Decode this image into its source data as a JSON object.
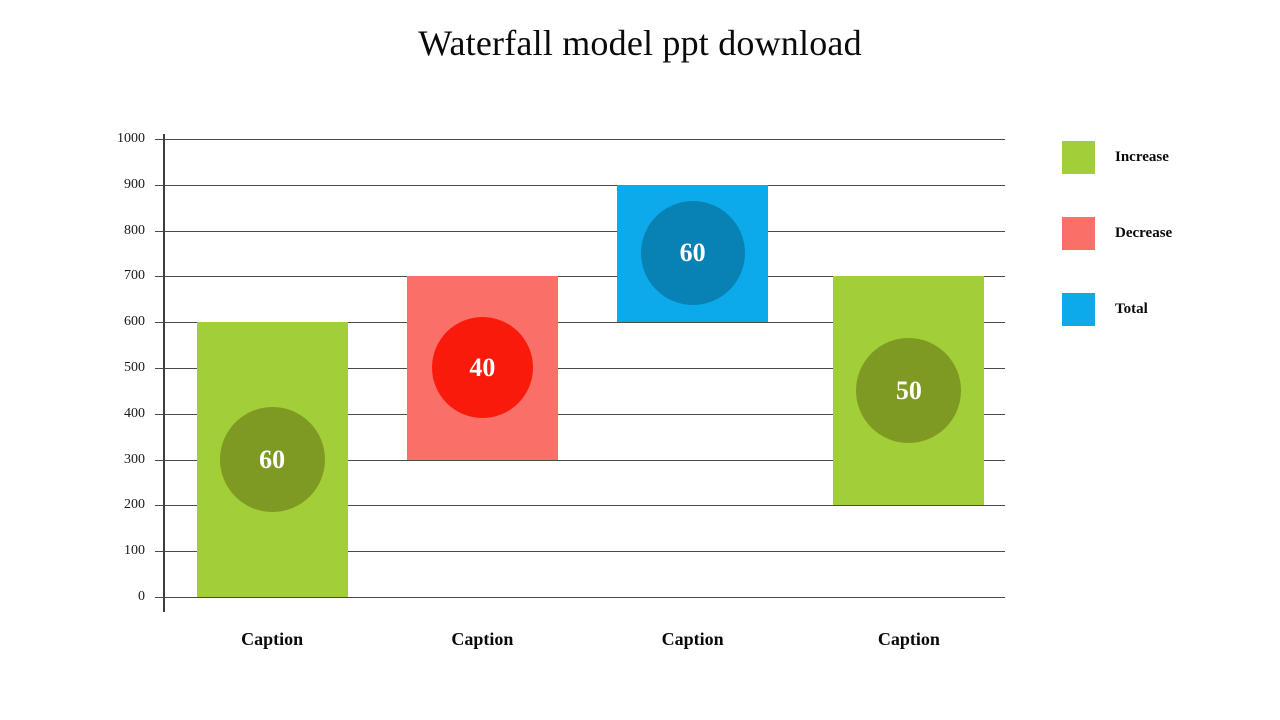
{
  "chart_data": {
    "type": "bar",
    "title": "Waterfall model ppt download",
    "xlabel": "",
    "ylabel": "",
    "ylim": [
      0,
      1000
    ],
    "y_ticks": [
      0,
      100,
      200,
      300,
      400,
      500,
      600,
      700,
      800,
      900,
      1000
    ],
    "y_tick_labels": [
      "0",
      "100",
      "200",
      "300",
      "400",
      "500",
      "600",
      "700",
      "800",
      "900",
      "1000"
    ],
    "grid": true,
    "legend_position": "right",
    "categories": [
      "Caption",
      "Caption",
      "Caption",
      "Caption"
    ],
    "bars": [
      {
        "label": "Caption",
        "base": 0,
        "top": 600,
        "value": 600,
        "kind": "Increase",
        "bar_color": "#A2CE38",
        "bubble_color": "#7E9A22",
        "bubble_label": "60"
      },
      {
        "label": "Caption",
        "base": 300,
        "top": 700,
        "value": 400,
        "kind": "Decrease",
        "bar_color": "#FB6F69",
        "bubble_color": "#FA1A0C",
        "bubble_label": "40"
      },
      {
        "label": "Caption",
        "base": 600,
        "top": 900,
        "value": 300,
        "kind": "Total",
        "bar_color": "#0CAAEA",
        "bubble_color": "#0882B5",
        "bubble_label": "60"
      },
      {
        "label": "Caption",
        "base": 200,
        "top": 700,
        "value": 500,
        "kind": "Increase",
        "bar_color": "#A2CE38",
        "bubble_color": "#7E9A22",
        "bubble_label": "50"
      }
    ],
    "legend": [
      {
        "label": "Increase",
        "color": "#A2CE38"
      },
      {
        "label": "Decrease",
        "color": "#FB6F69"
      },
      {
        "label": "Total",
        "color": "#0CAAEA"
      }
    ]
  }
}
